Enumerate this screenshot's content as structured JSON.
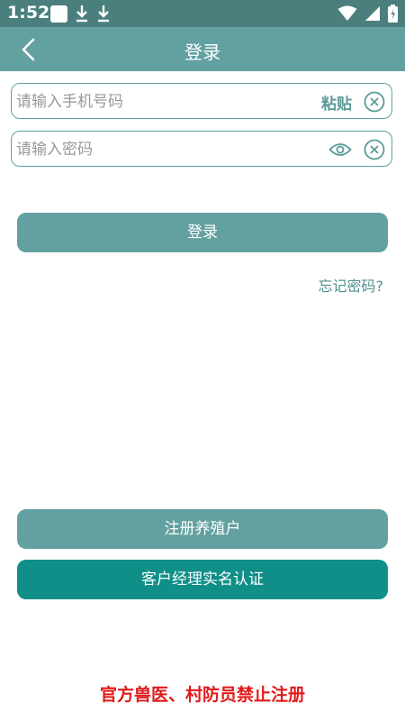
{
  "status_bar": {
    "time": "1:52"
  },
  "header": {
    "title": "登录"
  },
  "form": {
    "phone_placeholder": "请输入手机号码",
    "phone_value": "",
    "paste_label": "粘贴",
    "password_placeholder": "请输入密码",
    "password_value": ""
  },
  "actions": {
    "login_label": "登录",
    "forgot_label": "忘记密码?",
    "register_label": "注册养殖户",
    "verify_label": "客户经理实名认证"
  },
  "notice": {
    "text": "官方兽医、村防员禁止注册"
  },
  "colors": {
    "status_bar": "#4a7f7d",
    "primary": "#63a0a0",
    "accent_dark": "#0f8f88",
    "warning": "#e01a1a"
  }
}
